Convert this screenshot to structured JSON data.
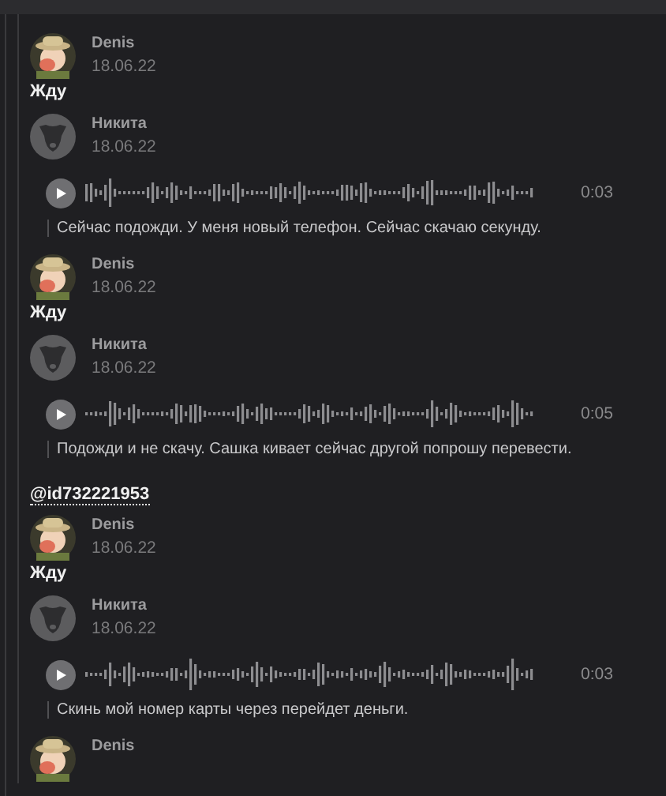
{
  "messages": [
    {
      "kind": "text",
      "author": "Denis",
      "avatar": {
        "kind": "photo"
      },
      "date": "18.06.22",
      "text": "Жду"
    },
    {
      "kind": "voice",
      "author": "Никита",
      "avatar": {
        "kind": "dog"
      },
      "date": "18.06.22",
      "duration": "0:03",
      "transcript": "Сейчас подожди. У меня новый телефон. Сейчас скачаю секунду."
    },
    {
      "kind": "text",
      "author": "Denis",
      "avatar": {
        "kind": "photo"
      },
      "date": "18.06.22",
      "text": "Жду"
    },
    {
      "kind": "voice",
      "author": "Никита",
      "avatar": {
        "kind": "dog"
      },
      "date": "18.06.22",
      "duration": "0:05",
      "transcript": "Подожди и не скачу. Сашка кивает сейчас другой попрошу перевести."
    },
    {
      "kind": "mention",
      "text": "@id732221953"
    },
    {
      "kind": "text",
      "author": "Denis",
      "avatar": {
        "kind": "photo"
      },
      "date": "18.06.22",
      "text": "Жду"
    },
    {
      "kind": "voice",
      "author": "Никита",
      "avatar": {
        "kind": "dog"
      },
      "date": "18.06.22",
      "duration": "0:03",
      "transcript": "Скинь мой номер карты через перейдет деньги."
    },
    {
      "kind": "header",
      "author": "Denis",
      "avatar": {
        "kind": "photo"
      }
    }
  ]
}
